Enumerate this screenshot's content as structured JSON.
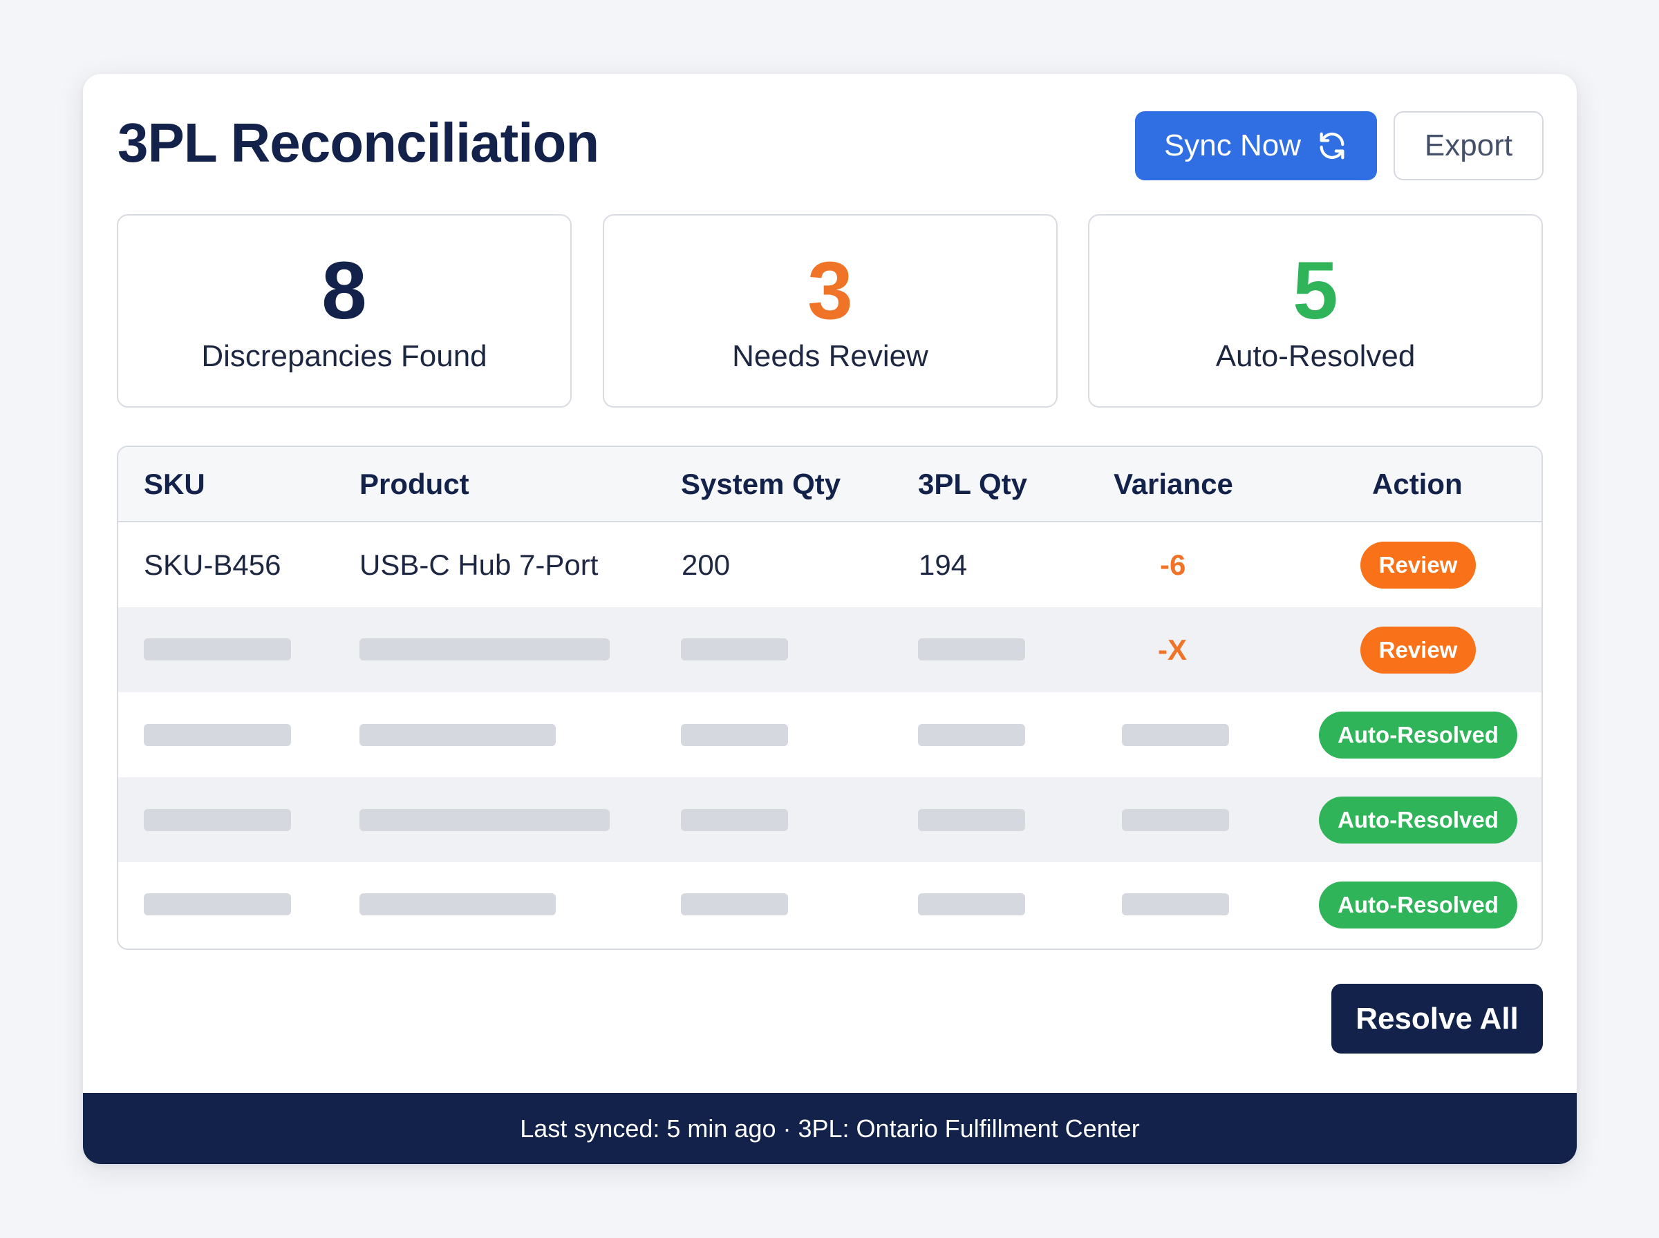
{
  "header": {
    "title": "3PL Reconciliation",
    "sync_label": "Sync Now",
    "export_label": "Export"
  },
  "stats": [
    {
      "value": "8",
      "label": "Discrepancies Found",
      "color": "#13224a"
    },
    {
      "value": "3",
      "label": "Needs Review",
      "color": "#f07428"
    },
    {
      "value": "5",
      "label": "Auto-Resolved",
      "color": "#2fb45a"
    }
  ],
  "table": {
    "columns": [
      "SKU",
      "Product",
      "System Qty",
      "3PL Qty",
      "Variance",
      "Action"
    ],
    "rows": [
      {
        "sku": "SKU-B456",
        "product": "USB-C Hub 7-Port",
        "system_qty": "200",
        "tpl_qty": "194",
        "variance": "-6",
        "action": "Review",
        "status": "review"
      },
      {
        "sku": "",
        "product": "",
        "system_qty": "",
        "tpl_qty": "",
        "variance": "-X",
        "action": "Review",
        "status": "review"
      },
      {
        "sku": "",
        "product": "",
        "system_qty": "",
        "tpl_qty": "",
        "variance": "",
        "action": "Auto-Resolved",
        "status": "auto"
      },
      {
        "sku": "",
        "product": "",
        "system_qty": "",
        "tpl_qty": "",
        "variance": "",
        "action": "Auto-Resolved",
        "status": "auto"
      },
      {
        "sku": "",
        "product": "",
        "system_qty": "",
        "tpl_qty": "",
        "variance": "",
        "action": "Auto-Resolved",
        "status": "auto"
      }
    ]
  },
  "resolve_all_label": "Resolve All",
  "footer": {
    "text": "Last synced: 5 min ago · 3PL: Ontario Fulfillment Center"
  },
  "colors": {
    "navy": "#13224a",
    "primary_blue": "#2f6fe3",
    "review_orange": "#f97219",
    "resolved_green": "#2fb45a"
  },
  "icons": {
    "sync": "refresh-icon"
  }
}
